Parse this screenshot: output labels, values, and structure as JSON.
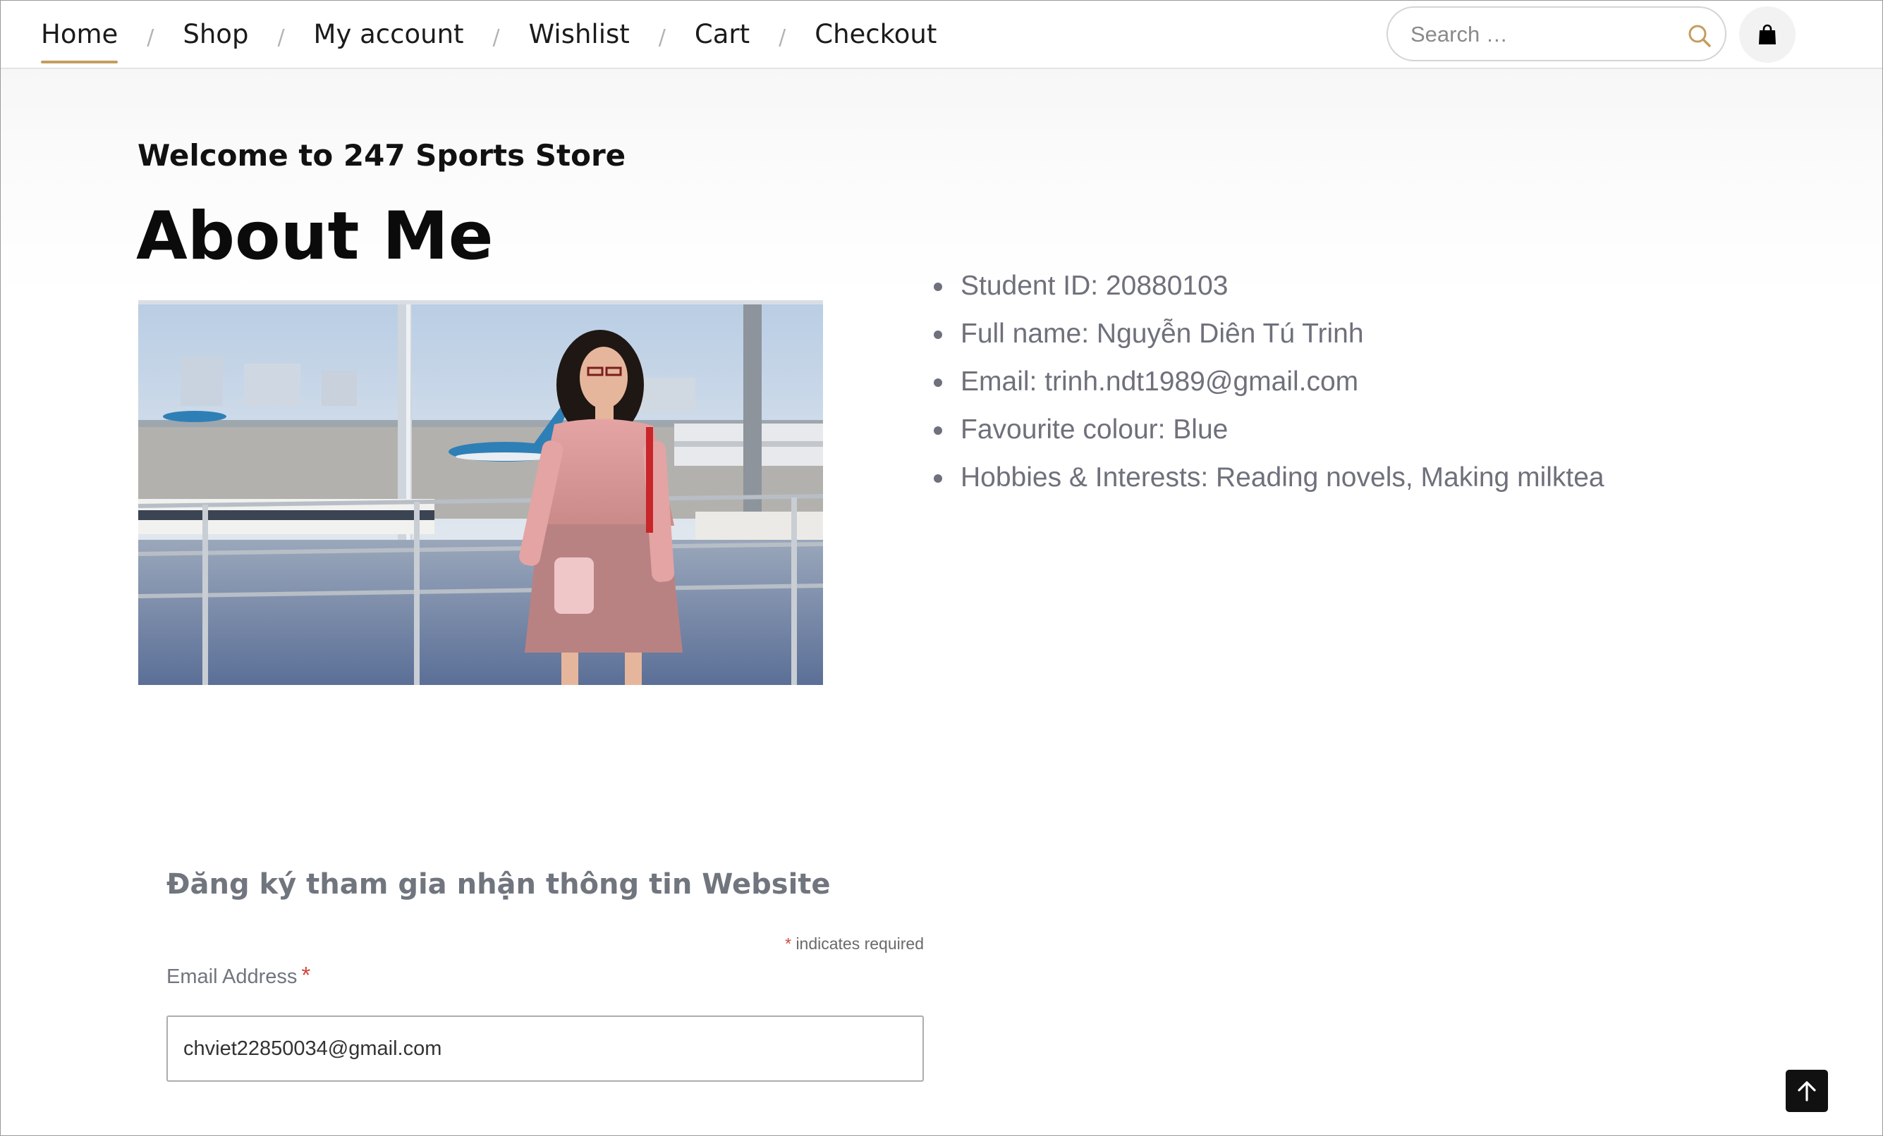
{
  "header": {
    "nav": [
      {
        "label": "Home",
        "active": true
      },
      {
        "label": "Shop"
      },
      {
        "label": "My account"
      },
      {
        "label": "Wishlist"
      },
      {
        "label": "Cart"
      },
      {
        "label": "Checkout"
      }
    ],
    "separator": "/",
    "search": {
      "placeholder": "Search …",
      "value": "",
      "icon": "search-icon"
    },
    "cart_icon": "shopping-bag-icon"
  },
  "page": {
    "site_welcome": "Welcome to 247 Sports Store",
    "title": "About Me"
  },
  "profile": {
    "items": [
      "Student ID: 20880103",
      "Full name: Nguyễn Diên Tú Trinh",
      "Email: trinh.ndt1989@gmail.com",
      "Favourite colour: Blue",
      "Hobbies & Interests: Reading novels, Making milktea"
    ]
  },
  "newsletter": {
    "title": "Đăng ký tham gia nhận thông tin Website",
    "required_mark": "*",
    "required_note": "indicates required",
    "email_label": "Email Address",
    "email_value": "chviet22850034@gmail.com"
  },
  "back_to_top_icon": "arrow-up-icon",
  "colors": {
    "accent": "#c59d5f",
    "text_muted": "#6e717b",
    "required": "#d0463e"
  }
}
